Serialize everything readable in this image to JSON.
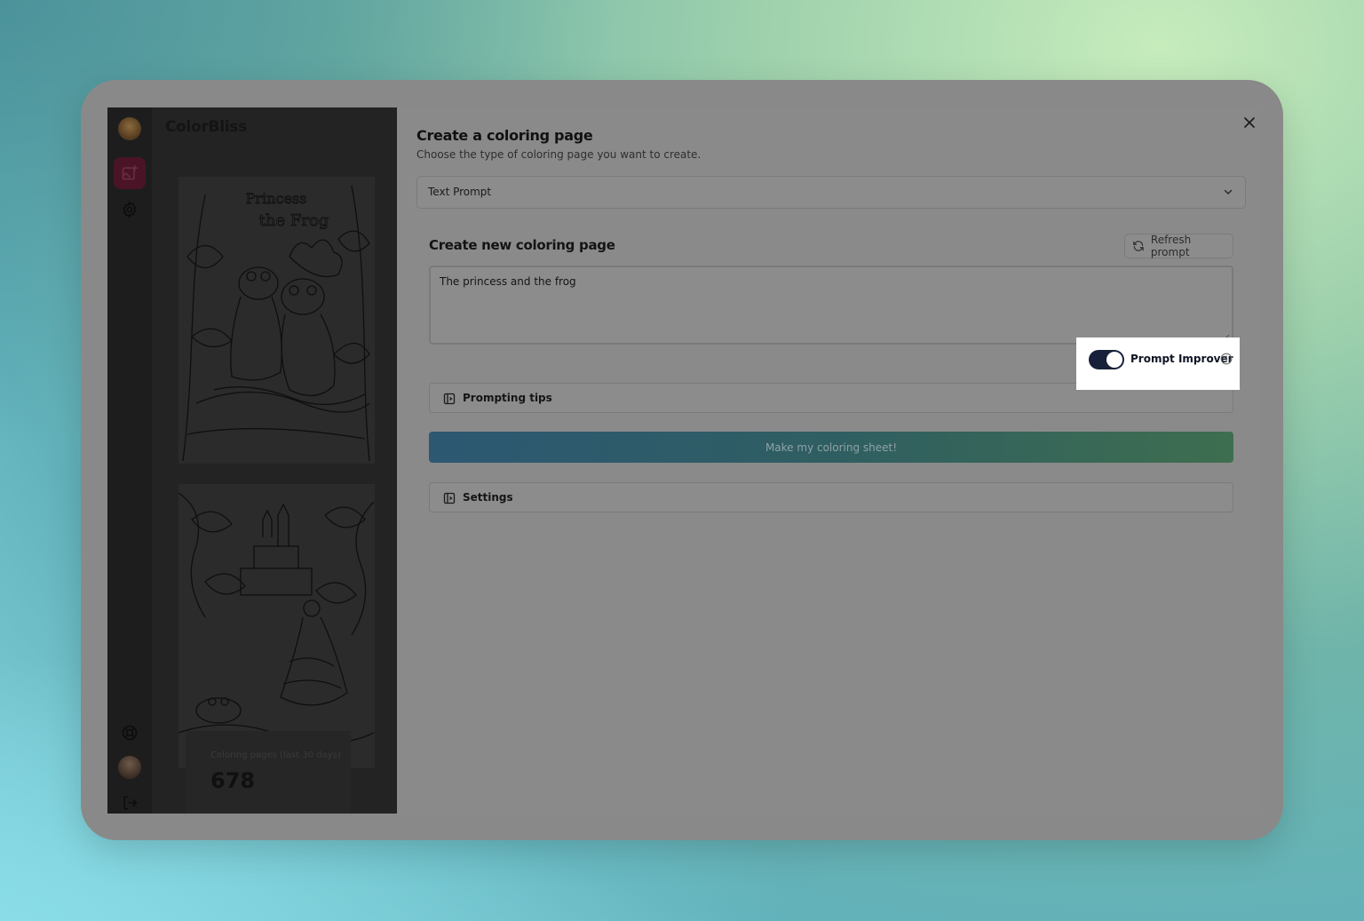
{
  "app": {
    "brand": "ColorBliss"
  },
  "gallery": {
    "stats_label": "Coloring pages (last 30 days)",
    "stats_value": "678"
  },
  "dialog": {
    "title": "Create a coloring page",
    "subtitle": "Choose the type of coloring page you want to create.",
    "type_select": {
      "value": "Text Prompt"
    },
    "section_title": "Create new coloring page",
    "refresh_label": "Refresh prompt",
    "prompt_value": "The princess and the frog",
    "prompt_improver": {
      "label": "Prompt Improver",
      "enabled": true
    },
    "prompting_tips_label": "Prompting tips",
    "submit_label": "Make my coloring sheet!",
    "settings_label": "Settings"
  },
  "colors": {
    "toggle_on": "#17203a",
    "cta_gradient": [
      "#2c5872",
      "#3e6e4f"
    ]
  }
}
